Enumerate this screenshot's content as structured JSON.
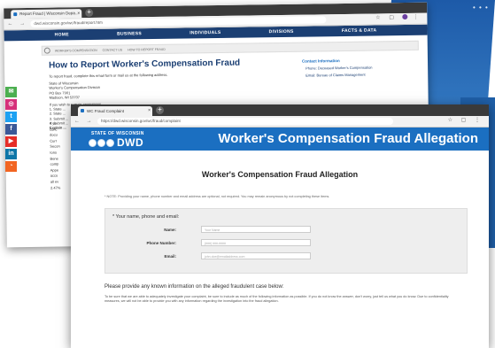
{
  "desktop": {
    "dots": "• • •"
  },
  "back_window": {
    "tab_title": "Report Fraud | Wisconsin Depa...",
    "url": "dwd.wisconsin.gov/wc/fraud/report.htm",
    "nav": [
      "HOME",
      "BUSINESS",
      "INDIVIDUALS",
      "DIVISIONS",
      "FACTS & DATA"
    ],
    "breadcrumb": [
      "WORKER'S COMPENSATION",
      "CONTACT US",
      "HOW TO REPORT FRAUD"
    ],
    "heading": "How to Report Worker's Compensation Fraud",
    "intro": "To report fraud, complete this email form or mail us at the following address.",
    "address": [
      "State of Wisconsin",
      "Worker's Compensation Division",
      "PO Box 7901",
      "Madison, WI 53707"
    ],
    "steps": [
      "If you wish to remain anonymous...",
      "1. State ...",
      "2. State ...",
      "3. Submit ...",
      "4. Submit ...",
      "Explain ..."
    ],
    "contact": {
      "heading": "Contact Information",
      "items": [
        "Phone: Deceased Worker's Compensation",
        "Email: Bureau of Claims Management"
      ]
    },
    "truncated_lines": [
      "If yo",
      "conc",
      "docu",
      "Curr",
      "Secon",
      "Ions",
      "Bene",
      "comp",
      "Appe",
      "accu",
      "all ev",
      "2.47%"
    ]
  },
  "social": [
    {
      "name": "email",
      "glyph": "✉",
      "color": "#4caf50"
    },
    {
      "name": "instagram",
      "glyph": "◎",
      "color": "#d6307a"
    },
    {
      "name": "twitter",
      "glyph": "t",
      "color": "#1da1f2"
    },
    {
      "name": "facebook",
      "glyph": "f",
      "color": "#3b5998"
    },
    {
      "name": "youtube",
      "glyph": "▶",
      "color": "#e52d27"
    },
    {
      "name": "linkedin",
      "glyph": "in",
      "color": "#0e76a8"
    },
    {
      "name": "rss",
      "glyph": "◔",
      "color": "#f26522"
    }
  ],
  "front_window": {
    "tab_title": "WC Fraud Complaint",
    "url": "https://dwd.wisconsin.gov/wc/fraud/complaint",
    "state_label": "STATE OF WISCONSIN",
    "logo_text": "DWD",
    "header_title": "Worker's Compensation Fraud Allegation",
    "form_title": "Worker's Compensation Fraud Allegation",
    "note": "* NOTE: Providing your name, phone number and email address are optional, not required. You may remain anonymous by not completing these items.",
    "panel_heading": "* Your name, phone and email:",
    "fields": [
      {
        "label": "Name:",
        "placeholder": "Your Name"
      },
      {
        "label": "Phone Number:",
        "placeholder": "(###) ###-####"
      },
      {
        "label": "Email:",
        "placeholder": "john.doe@emailaddress.com"
      }
    ],
    "section_heading": "Please provide any known information on the alleged fraudulent case below:",
    "section_text": "To be sure that we are able to adequately investigate your complaint, be sure to include as much of the following information as possible. If you do not know the answer, don't worry, just tell us what you do know. Due to confidentiality measures, we will not be able to provide you with any information regarding the investigation into the fraud allegation."
  }
}
